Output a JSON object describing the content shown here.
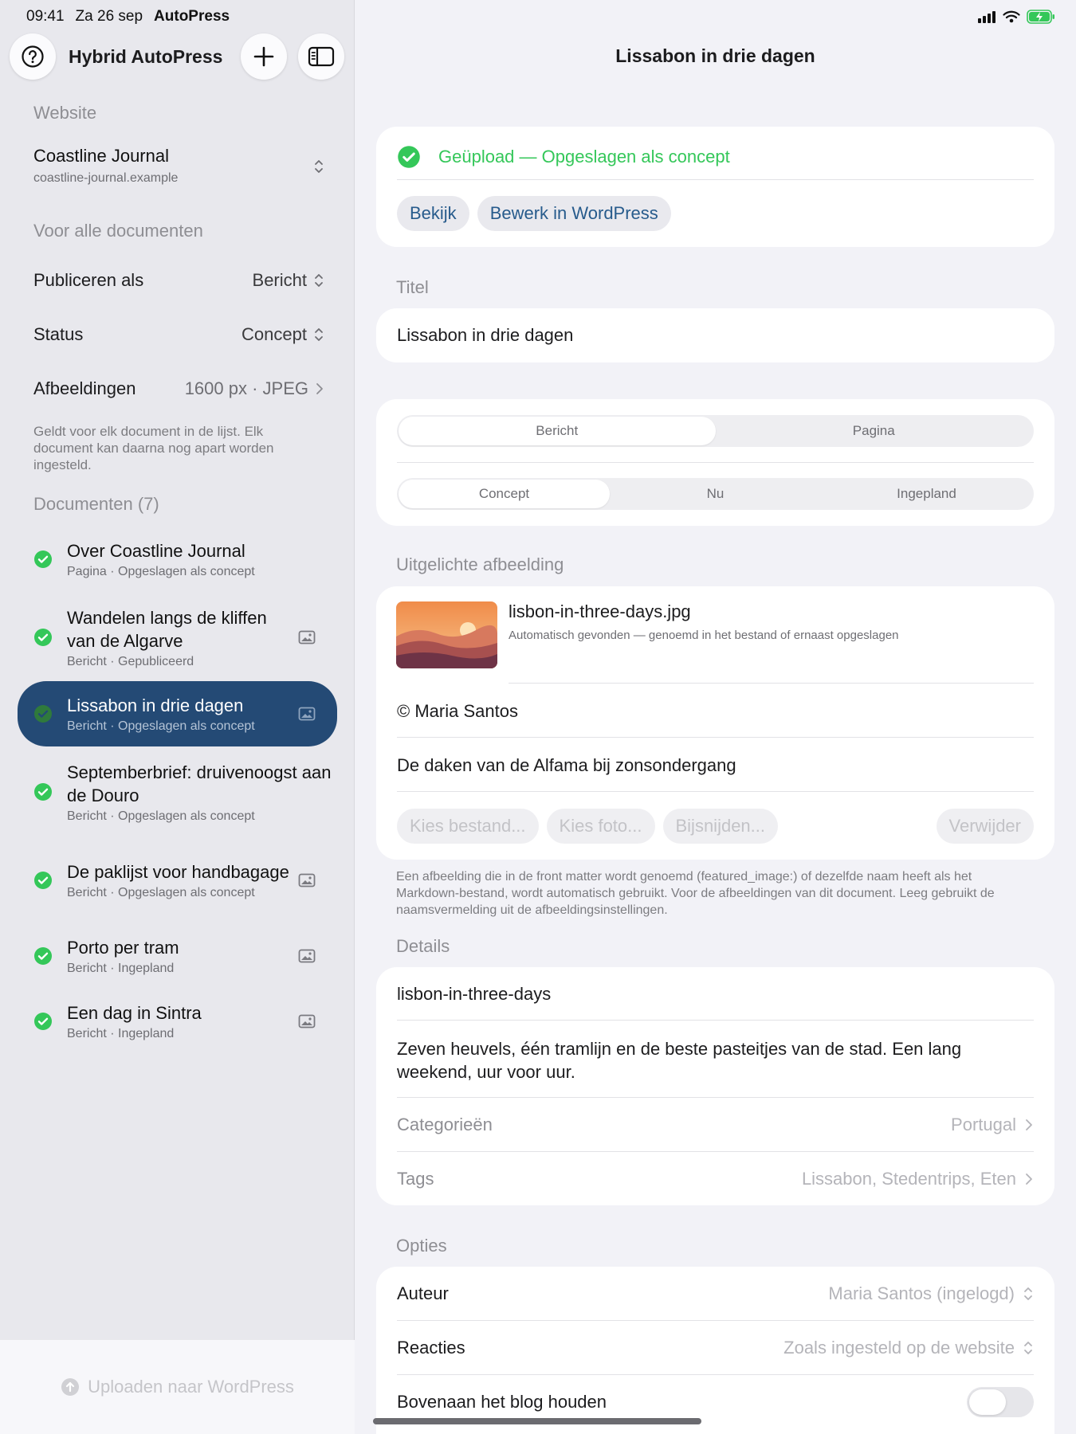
{
  "status_bar": {
    "time": "09:41",
    "date": "Za 26 sep",
    "app": "AutoPress"
  },
  "sidebar": {
    "title": "Hybrid AutoPress",
    "website_section": "Website",
    "site": {
      "name": "Coastline Journal",
      "url": "coastline-journal.example"
    },
    "all_docs_section": "Voor alle documenten",
    "settings": [
      {
        "label": "Publiceren als",
        "value": "Bericht"
      },
      {
        "label": "Status",
        "value": "Concept"
      },
      {
        "label": "Afbeeldingen",
        "value": "1600 px · JPEG"
      }
    ],
    "note": "Geldt voor elk document in de lijst. Elk document kan daarna nog apart worden ingesteld.",
    "documents_section": "Documenten (7)",
    "documents": [
      {
        "title": "Over Coastline Journal",
        "subtitle": "Pagina · Opgeslagen als concept",
        "has_image": false
      },
      {
        "title": "Wandelen langs de kliffen van de Algarve",
        "subtitle": "Bericht · Gepubliceerd",
        "has_image": true
      },
      {
        "title": "Lissabon in drie dagen",
        "subtitle": "Bericht · Opgeslagen als concept",
        "has_image": true,
        "selected": true
      },
      {
        "title": "Septemberbrief: druivenoogst aan de Douro",
        "subtitle": "Bericht · Opgeslagen als concept",
        "has_image": false
      },
      {
        "title": "De paklijst voor handbagage",
        "subtitle": "Bericht · Opgeslagen als concept",
        "has_image": true
      },
      {
        "title": "Porto per tram",
        "subtitle": "Bericht · Ingepland",
        "has_image": true
      },
      {
        "title": "Een dag in Sintra",
        "subtitle": "Bericht · Ingepland",
        "has_image": true
      }
    ],
    "upload_button": "Uploaden naar WordPress"
  },
  "main": {
    "title": "Lissabon in drie dagen",
    "upload_status": "Geüpload — Opgeslagen als concept",
    "view_button": "Bekijk",
    "edit_button": "Bewerk in WordPress",
    "title_section": "Titel",
    "title_value": "Lissabon in drie dagen",
    "type_options": [
      "Bericht",
      "Pagina"
    ],
    "type_selected": "Bericht",
    "status_options": [
      "Concept",
      "Nu",
      "Ingepland"
    ],
    "status_selected": "Concept",
    "featured_section": "Uitgelichte afbeelding",
    "image": {
      "filename": "lisbon-in-three-days.jpg",
      "found_note": "Automatisch gevonden — genoemd in het bestand of ernaast opgeslagen",
      "credit": "© Maria Santos",
      "caption": "De daken van de Alfama bij zonsondergang"
    },
    "image_buttons": {
      "choose_file": "Kies bestand...",
      "choose_photo": "Kies foto...",
      "crop": "Bijsnijden...",
      "remove": "Verwijder"
    },
    "featured_note": "Een afbeelding die in de front matter wordt genoemd (featured_image:) of dezelfde naam heeft als het Markdown-bestand, wordt automatisch gebruikt. Voor de afbeeldingen van dit document. Leeg gebruikt de naamsvermelding uit de afbeeldingsinstellingen.",
    "details_section": "Details",
    "slug": "lisbon-in-three-days",
    "excerpt": "Zeven heuvels, één tramlijn en de beste pasteitjes van de stad. Een lang weekend, uur voor uur.",
    "categories_label": "Categorieën",
    "categories_value": "Portugal",
    "tags_label": "Tags",
    "tags_value": "Lissabon, Stedentrips, Eten",
    "options_section": "Opties",
    "author_label": "Auteur",
    "author_value": "Maria Santos (ingelogd)",
    "comments_label": "Reacties",
    "comments_value": "Zoals ingesteld op de website",
    "sticky_label": "Bovenaan het blog houden",
    "sticky_on": false
  },
  "colors": {
    "accent": "#244a75",
    "success": "#34c759",
    "link": "#275b8c"
  }
}
